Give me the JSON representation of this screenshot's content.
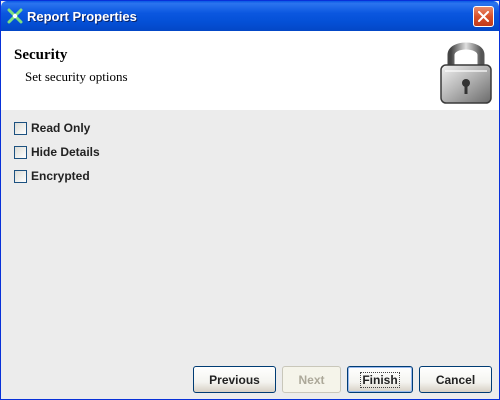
{
  "window": {
    "title": "Report Properties"
  },
  "header": {
    "title": "Security",
    "subtitle": "Set security options",
    "icon": "padlock-icon"
  },
  "options": [
    {
      "label": "Read Only",
      "checked": false
    },
    {
      "label": "Hide Details",
      "checked": false
    },
    {
      "label": "Encrypted",
      "checked": false
    }
  ],
  "buttons": {
    "previous": "Previous",
    "next": "Next",
    "finish": "Finish",
    "cancel": "Cancel"
  },
  "colors": {
    "titlebar": "#0450d6",
    "body": "#ececec",
    "header_bg": "#ffffff"
  }
}
